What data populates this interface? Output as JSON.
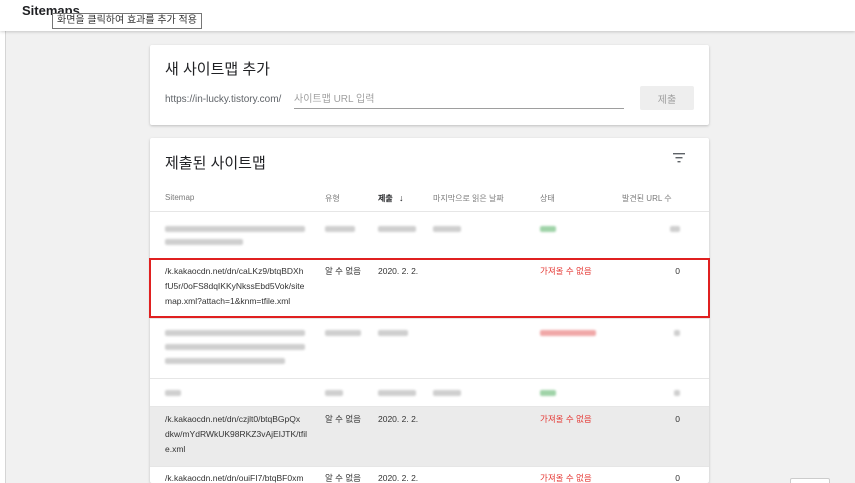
{
  "topbar": {
    "title": "Sitemaps",
    "tooltip": "화면을 클릭하여 효과를 추가 적용"
  },
  "add_card": {
    "title": "새 사이트맵 추가",
    "url_prefix": "https://in-lucky.tistory.com/",
    "input_placeholder": "사이트맵 URL 입력",
    "submit_label": "제출"
  },
  "list_card": {
    "title": "제출된 사이트맵",
    "filter_icon": "filter-icon",
    "columns": [
      "Sitemap",
      "유형",
      "제출",
      "마지막으로 읽은 날짜",
      "상태",
      "발견된 URL 수"
    ],
    "sort_icon": "arrow-down-icon",
    "rows": [
      {
        "url_lines": [
          "/k.kakaocdn.net/dn/caLKz9/btqBDXh",
          "fU5r/0oFS8dqIKKyNkssEbd5Vok/site",
          "map.xml?attach=1&knm=tfile.xml"
        ],
        "type": "알 수 없음",
        "submitted": "2020. 2. 2.",
        "status": "가져올 수 없음",
        "found": "0"
      },
      {
        "url_lines": [
          "/k.kakaocdn.net/dn/czjlt0/btqBGpQx",
          "dkw/mYdRWkUK98RKZ3vAjEIJTK/tfil",
          "e.xml"
        ],
        "type": "알 수 없음",
        "submitted": "2020. 2. 2.",
        "status": "가져올 수 없음",
        "found": "0"
      },
      {
        "url_lines": [
          "/k.kakaocdn.net/dn/ouiFI7/btqBF0xm"
        ],
        "type": "알 수 없음",
        "submitted": "2020. 2. 2.",
        "status": "가져올 수 없음",
        "found": "0"
      }
    ]
  },
  "colors": {
    "error": "#e53935",
    "highlight": "#e02020"
  }
}
